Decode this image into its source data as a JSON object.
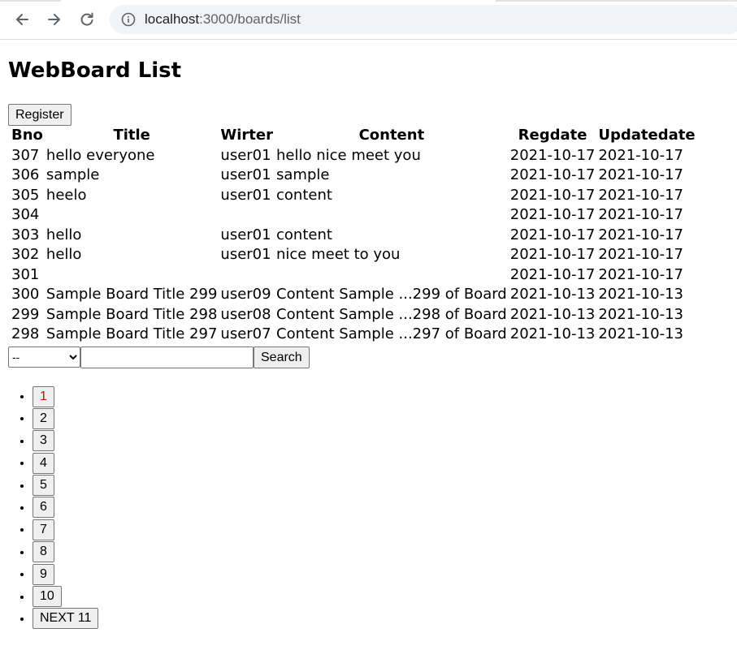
{
  "browser": {
    "url": "localhost:3000/boards/list",
    "url_host": "localhost",
    "url_rest": ":3000/boards/list",
    "icons": [
      "back-arrow-icon",
      "forward-arrow-icon",
      "reload-icon",
      "info-icon"
    ]
  },
  "page": {
    "title": "WebBoard List",
    "register_label": "Register"
  },
  "table": {
    "headers": [
      "Bno",
      "Title",
      "Wirter",
      "Content",
      "Regdate",
      "Updatedate"
    ],
    "rows": [
      [
        "307",
        "hello everyone",
        "user01",
        "hello nice meet you",
        "2021-10-17",
        "2021-10-17"
      ],
      [
        "306",
        "sample",
        "user01",
        "sample",
        "2021-10-17",
        "2021-10-17"
      ],
      [
        "305",
        "heelo",
        "user01",
        "content",
        "2021-10-17",
        "2021-10-17"
      ],
      [
        "304",
        "",
        "",
        "",
        "2021-10-17",
        "2021-10-17"
      ],
      [
        "303",
        "hello",
        "user01",
        "content",
        "2021-10-17",
        "2021-10-17"
      ],
      [
        "302",
        "hello",
        "user01",
        "nice meet to you",
        "2021-10-17",
        "2021-10-17"
      ],
      [
        "301",
        "",
        "",
        "",
        "2021-10-17",
        "2021-10-17"
      ],
      [
        "300",
        "Sample Board Title 299",
        "user09",
        "Content Sample ...299 of Board",
        "2021-10-13",
        "2021-10-13"
      ],
      [
        "299",
        "Sample Board Title 298",
        "user08",
        "Content Sample ...298 of Board",
        "2021-10-13",
        "2021-10-13"
      ],
      [
        "298",
        "Sample Board Title 297",
        "user07",
        "Content Sample ...297 of Board",
        "2021-10-13",
        "2021-10-13"
      ]
    ]
  },
  "search": {
    "type_selected": "--",
    "keyword_value": "",
    "button_label": "Search"
  },
  "pagination": {
    "current": "1",
    "current_color": "#e00000",
    "pages": [
      "1",
      "2",
      "3",
      "4",
      "5",
      "6",
      "7",
      "8",
      "9",
      "10"
    ],
    "next_label": "NEXT 11"
  }
}
